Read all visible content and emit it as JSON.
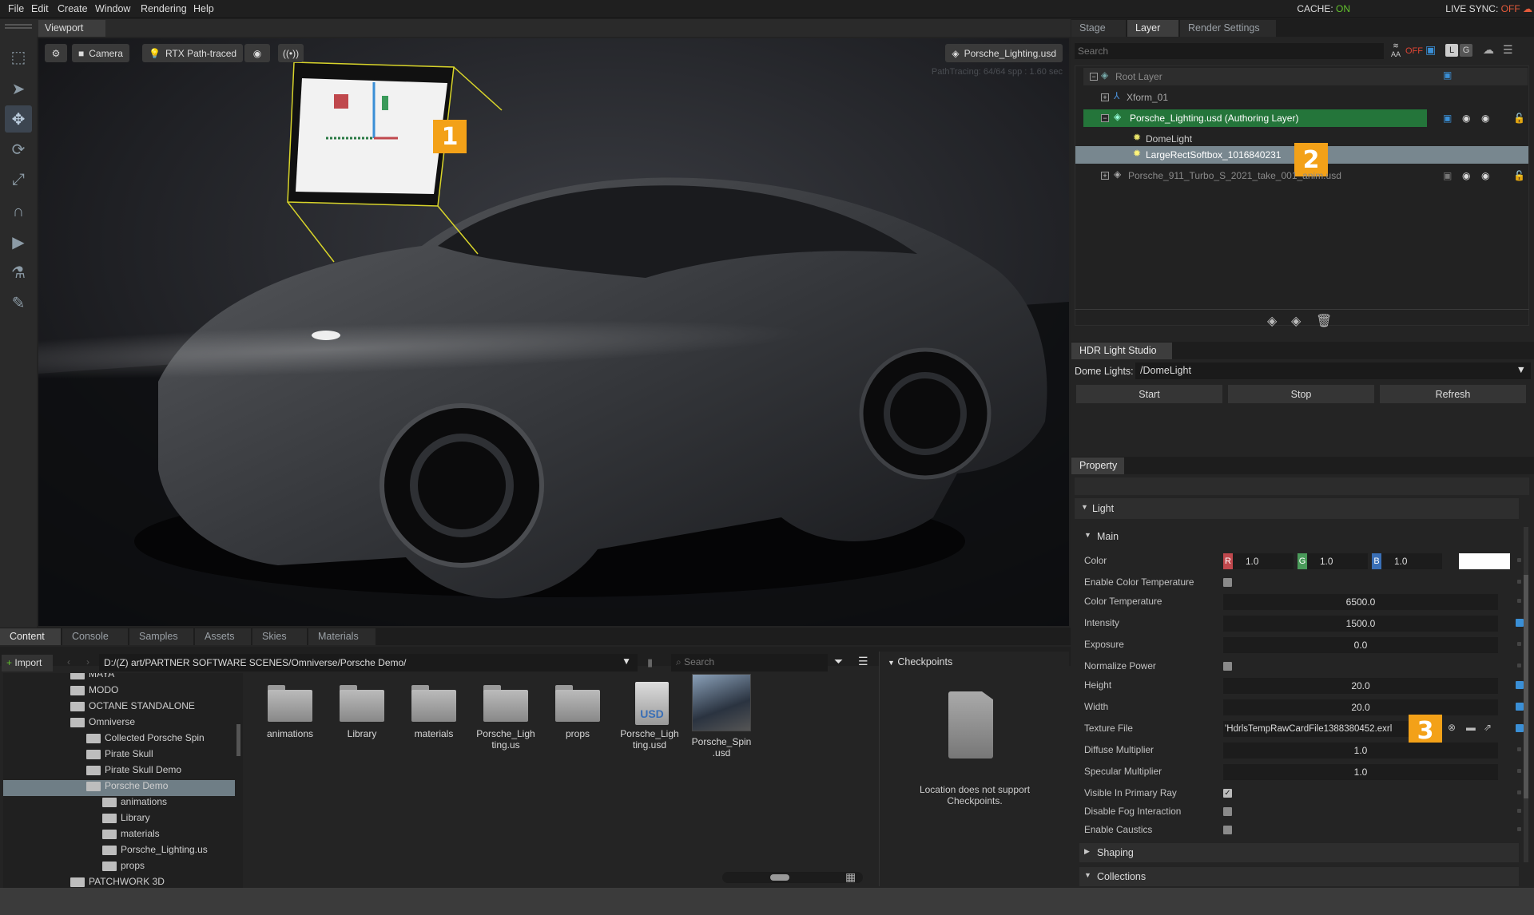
{
  "menubar": {
    "items": [
      "File",
      "Edit",
      "Create",
      "Window",
      "Rendering",
      "Help"
    ],
    "cache_label": "CACHE:",
    "cache_value": "ON",
    "sync_label": "LIVE SYNC:",
    "sync_value": "OFF"
  },
  "viewport": {
    "tab": "Viewport",
    "camera_label": "Camera",
    "render_mode": "RTX Path-traced",
    "stage_file": "Porsche_Lighting.usd",
    "path_tracing_info": "PathTracing: 64/64 spp : 1.60 sec",
    "badge1": "1"
  },
  "right_tabs": [
    "Stage",
    "Layer",
    "Render Settings"
  ],
  "layer": {
    "search_placeholder": "Search",
    "off_label": "OFF",
    "aa_label": "AA",
    "l_label": "L",
    "g_label": "G",
    "rows": {
      "root": "Root Layer",
      "xform": "Xform_01",
      "authoring": "Porsche_Lighting.usd (Authoring Layer)",
      "dome": "DomeLight",
      "softbox": "LargeRectSoftbox_1016840231",
      "anim": "Porsche_911_Turbo_S_2021_take_001_anim.usd"
    },
    "badge2": "2"
  },
  "hdr": {
    "tab": "HDR Light Studio",
    "dome_label": "Dome Lights:",
    "dome_value": "/DomeLight",
    "start": "Start",
    "stop": "Stop",
    "refresh": "Refresh"
  },
  "property": {
    "tab": "Property",
    "section_light": "Light",
    "section_main": "Main",
    "color_label": "Color",
    "r_label": "R",
    "g_label": "G",
    "b_label": "B",
    "r": "1.0",
    "g": "1.0",
    "b": "1.0",
    "enable_color_temp": "Enable Color Temperature",
    "color_temp_label": "Color Temperature",
    "color_temp": "6500.0",
    "intensity_label": "Intensity",
    "intensity": "1500.0",
    "exposure_label": "Exposure",
    "exposure": "0.0",
    "normalize_label": "Normalize Power",
    "height_label": "Height",
    "height": "20.0",
    "width_label": "Width",
    "width": "20.0",
    "texture_label": "Texture File",
    "texture": "'HdrlsTempRawCardFile1388380452.exrl",
    "diffuse_label": "Diffuse Multiplier",
    "diffuse": "1.0",
    "specular_label": "Specular Multiplier",
    "specular": "1.0",
    "visible_label": "Visible In Primary Ray",
    "fog_label": "Disable Fog Interaction",
    "caustics_label": "Enable Caustics",
    "section_shaping": "Shaping",
    "section_collections": "Collections",
    "badge3": "3"
  },
  "content": {
    "tabs": [
      "Content",
      "Console",
      "Samples",
      "Assets",
      "Skies",
      "Materials"
    ],
    "import": "Import",
    "path": "D:/(Z) art/PARTNER SOFTWARE SCENES/Omniverse/Porsche Demo/",
    "search_placeholder": "Search",
    "tree": {
      "maya": "MAYA",
      "modo": "MODO",
      "octane": "OCTANE STANDALONE",
      "omniverse": "Omniverse",
      "collected": "Collected Porsche Spin",
      "pirate": "Pirate Skull",
      "pirate_demo": "Pirate Skull Demo",
      "porsche_demo": "Porsche Demo",
      "animations": "animations",
      "library": "Library",
      "materials": "materials",
      "lighting": "Porsche_Lighting.us",
      "props": "props",
      "patchwork": "PATCHWORK 3D"
    },
    "grid": {
      "animations": "animations",
      "library": "Library",
      "materials": "materials",
      "lighting_us_1": "Porsche_Ligh",
      "lighting_us_2": "ting.us",
      "props": "props",
      "lighting_usd_1": "Porsche_Ligh",
      "lighting_usd_2": "ting.usd",
      "spin_1": "Porsche_Spin",
      "spin_2": ".usd",
      "usd_glyph": "USD"
    },
    "checkpoints": {
      "title": "Checkpoints",
      "msg1": "Location does not support",
      "msg2": "Checkpoints."
    }
  }
}
